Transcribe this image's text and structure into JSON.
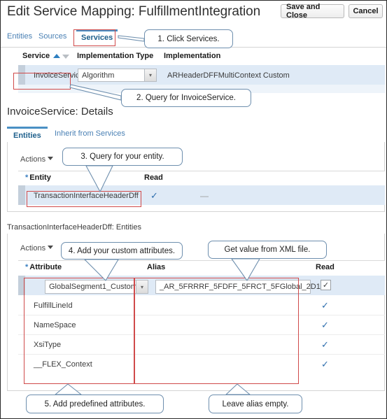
{
  "header": {
    "title": "Edit Service Mapping: FulfillmentIntegration",
    "save_label": "Save and Close",
    "cancel_label": "Cancel"
  },
  "top_tabs": [
    {
      "label": "Entities",
      "active": false
    },
    {
      "label": "Sources",
      "active": false
    },
    {
      "label": "Services",
      "active": true
    }
  ],
  "services_table": {
    "columns": [
      "Service",
      "Implementation Type",
      "Implementation"
    ],
    "sort_icon_asc": "sort-ascending-icon",
    "sort_icon_desc": "sort-descending-icon",
    "row": {
      "service": "InvoiceService",
      "implementation_type": "Algorithm",
      "implementation": "ARHeaderDFFMultiContext Custom"
    }
  },
  "details": {
    "title": "InvoiceService: Details",
    "sub_tabs": [
      {
        "label": "Entities",
        "active": true
      },
      {
        "label": "Inherit from Services",
        "active": false
      }
    ]
  },
  "entities_panel": {
    "actions_label": "Actions",
    "columns": [
      "Entity",
      "Read"
    ],
    "required_marker": "*",
    "rows": [
      {
        "entity": "TransactionInterfaceHeaderDff",
        "read": "✓",
        "extra": "—"
      }
    ]
  },
  "attributes_panel": {
    "title": "TransactionInterfaceHeaderDff: Entities",
    "actions_label": "Actions",
    "columns": [
      "Attribute",
      "Alias",
      "Read"
    ],
    "required_marker": "*",
    "rows": [
      {
        "attribute": "GlobalSegment1_Custom",
        "alias": "_AR_5FRRRF_5FDFF_5FRCT_5FGlobal_2D1",
        "read": "✓",
        "selected": true,
        "editable": true
      },
      {
        "attribute": "FulfillLineId",
        "alias": "",
        "read": "✓",
        "selected": false,
        "editable": false
      },
      {
        "attribute": "NameSpace",
        "alias": "",
        "read": "✓",
        "selected": false,
        "editable": false
      },
      {
        "attribute": "XsiType",
        "alias": "",
        "read": "✓",
        "selected": false,
        "editable": false
      },
      {
        "attribute": "__FLEX_Context",
        "alias": "",
        "read": "✓",
        "selected": false,
        "editable": false
      }
    ]
  },
  "callouts": [
    {
      "id": "c1",
      "text": "1. Click Services."
    },
    {
      "id": "c2",
      "text": "2. Query for InvoiceService."
    },
    {
      "id": "c3",
      "text": "3. Query for your entity."
    },
    {
      "id": "c4",
      "text": "4. Add your custom attributes."
    },
    {
      "id": "c5",
      "text": "Get value from XML file."
    },
    {
      "id": "c6",
      "text": "5. Add predefined attributes."
    },
    {
      "id": "c7",
      "text": "Leave alias empty."
    }
  ],
  "colors": {
    "highlight_red": "#d04a4a",
    "callout_border": "#6e8fae",
    "accent_blue": "#2e7fc0",
    "selected_row": "#dfeaf6"
  }
}
